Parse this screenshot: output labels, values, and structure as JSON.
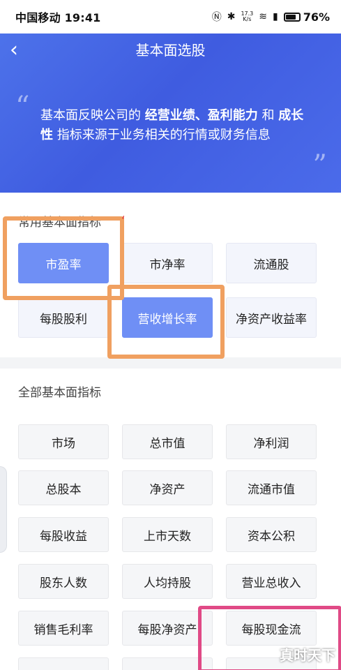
{
  "status_bar": {
    "carrier_time": "中国移动 19:41",
    "icons": [
      "nfc-icon",
      "bluetooth-icon",
      "wifi-icon",
      "signal-icon"
    ],
    "net_speed_value": "17.3",
    "net_speed_unit": "K/s",
    "battery": "76%"
  },
  "header": {
    "back_label": "‹",
    "title": "基本面选股",
    "description_parts": {
      "p1": "基本面反映公司的 ",
      "em1": "经营业绩、盈利能力",
      "p2": " 和 ",
      "em2": "成长性",
      "p3": " 指标来源于业务相关的行情或财务信息"
    },
    "quote_open": "“",
    "quote_close": "”"
  },
  "common_section": {
    "title": "常用基本面指标",
    "items": [
      {
        "label": "市盈率",
        "active": true
      },
      {
        "label": "市净率",
        "active": false
      },
      {
        "label": "流通股",
        "active": false
      },
      {
        "label": "每股股利",
        "active": false
      },
      {
        "label": "营收增长率",
        "active": true
      },
      {
        "label": "净资产收益率",
        "active": false
      }
    ]
  },
  "all_section": {
    "title": "全部基本面指标",
    "items": [
      "市场",
      "总市值",
      "净利润",
      "总股本",
      "净资产",
      "流通市值",
      "每股收益",
      "上市天数",
      "资本公积",
      "股东人数",
      "人均持股",
      "营业总收入",
      "销售毛利率",
      "每股净资产",
      "每股现金流"
    ]
  },
  "watermark": "真时天下",
  "colors": {
    "header_blue": "#4565e6",
    "chip_active": "#6f8ff5",
    "highlight_orange": "#f0a060",
    "highlight_pink": "#e04a86"
  }
}
